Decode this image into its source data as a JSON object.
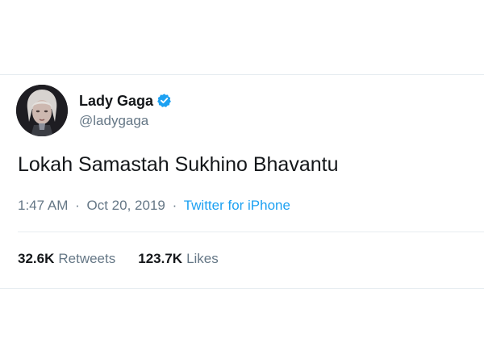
{
  "tweet": {
    "display_name": "Lady Gaga",
    "handle": "@ladygaga",
    "text": "Lokah Samastah Sukhino Bhavantu",
    "time": "1:47 AM",
    "separator": "·",
    "date": "Oct 20, 2019",
    "source": "Twitter for iPhone",
    "retweets_count": "32.6K",
    "retweets_label": "Retweets",
    "likes_count": "123.7K",
    "likes_label": "Likes"
  },
  "icons": {
    "verified": "verified-badge-icon",
    "avatar": "profile-photo"
  },
  "colors": {
    "text_primary": "#14171a",
    "text_secondary": "#657786",
    "accent": "#1da1f2",
    "divider": "#e6ecf0"
  }
}
